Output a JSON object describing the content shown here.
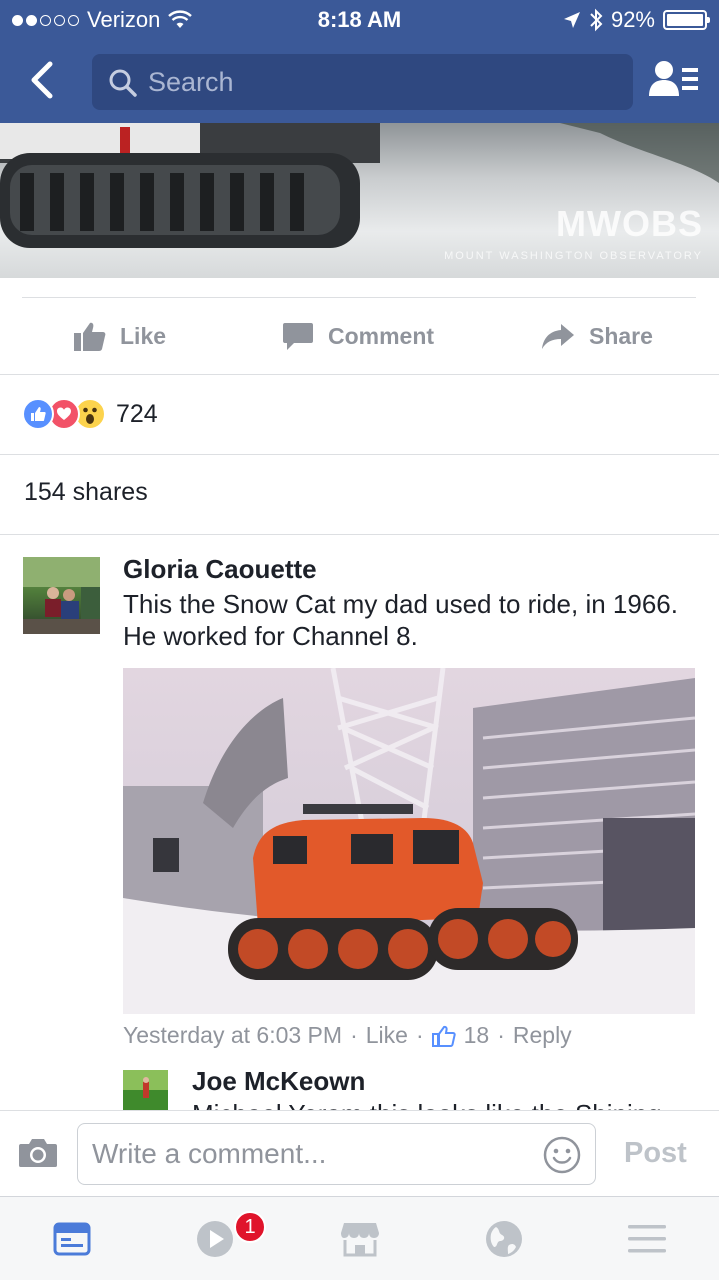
{
  "status_bar": {
    "carrier": "Verizon",
    "time": "8:18 AM",
    "battery": "92%",
    "battery_level": 0.92
  },
  "nav": {
    "search_placeholder": "Search"
  },
  "banner": {
    "watermark": "MWOBS",
    "watermark_sub": "MOUNT WASHINGTON OBSERVATORY"
  },
  "actions": {
    "like": "Like",
    "comment": "Comment",
    "share": "Share"
  },
  "reactions": {
    "count": "724"
  },
  "shares": "154 shares",
  "comment": {
    "author": "Gloria Caouette",
    "text": "This the Snow Cat my dad used to ride, in 1966. He worked for Channel 8.",
    "time": "Yesterday at 6:03 PM",
    "like_label": "Like",
    "like_count": "18",
    "reply_label": "Reply",
    "separator": "·"
  },
  "reply": {
    "author": "Joe McKeown",
    "text": "Michael Yeram this looks like the Shining"
  },
  "composer": {
    "placeholder": "Write a comment...",
    "post_label": "Post"
  },
  "tabbar": {
    "video_badge": "1"
  },
  "colors": {
    "brand_blue": "#3b5998",
    "like_blue": "#5890ff",
    "love_red": "#f25268",
    "wow_yellow": "#fcd34d",
    "badge_red": "#e0142b"
  }
}
